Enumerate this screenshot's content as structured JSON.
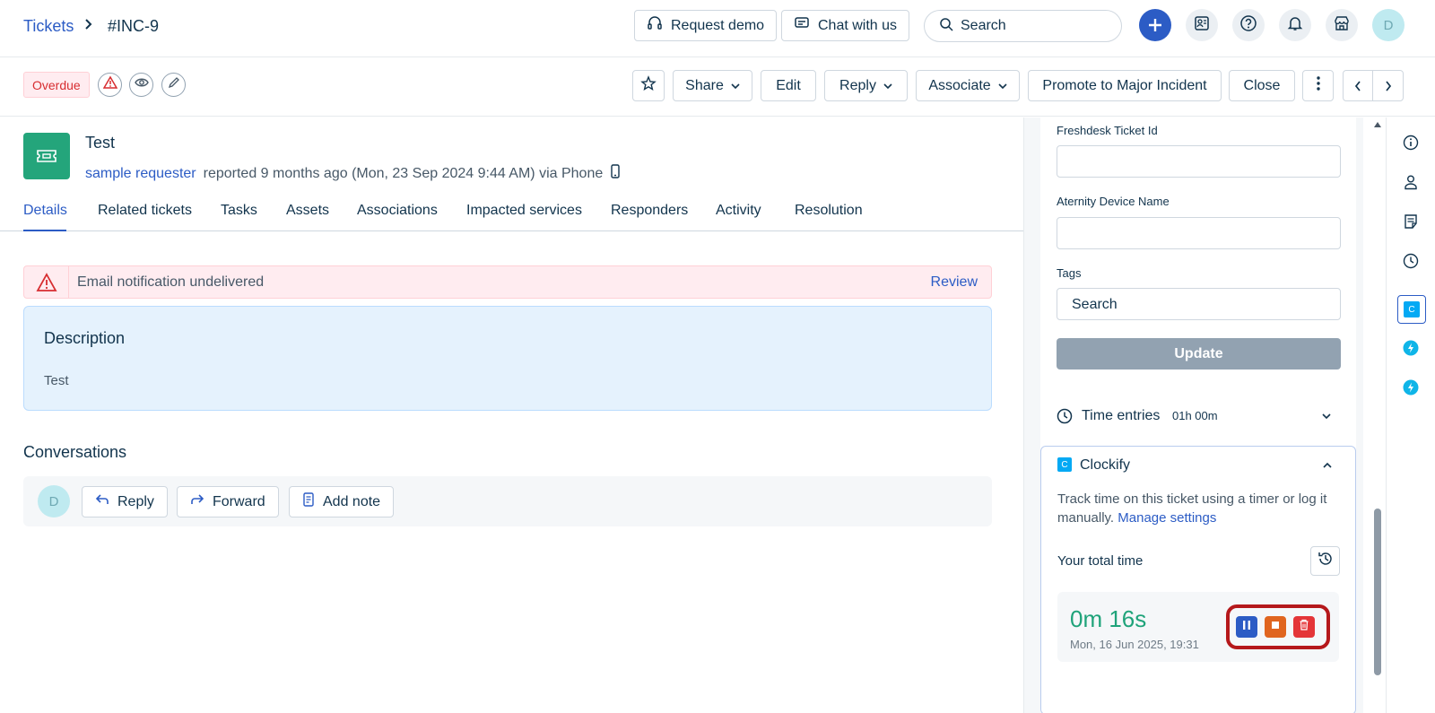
{
  "breadcrumb": {
    "root": "Tickets",
    "separator": ">",
    "current": "#INC-9"
  },
  "topbar": {
    "request_demo": "Request demo",
    "chat_with_us": "Chat with us",
    "search_placeholder": "Search",
    "avatar_initial": "D"
  },
  "actionbar": {
    "overdue_badge": "Overdue",
    "share": "Share",
    "edit": "Edit",
    "reply": "Reply",
    "associate": "Associate",
    "promote": "Promote to Major Incident",
    "close": "Close"
  },
  "ticket": {
    "subject": "Test",
    "requester": "sample requester",
    "meta": "reported 9 months ago (Mon, 23 Sep 2024 9:44 AM) via Phone"
  },
  "tabs": [
    "Details",
    "Related tickets",
    "Tasks",
    "Assets",
    "Associations",
    "Impacted services",
    "Responders",
    "Activity",
    "Resolution"
  ],
  "alert": {
    "message": "Email notification undelivered",
    "action": "Review"
  },
  "description": {
    "title": "Description",
    "body": "Test"
  },
  "conversations": {
    "title": "Conversations",
    "avatar_initial": "D",
    "reply": "Reply",
    "forward": "Forward",
    "add_note": "Add note"
  },
  "properties": {
    "freshdesk_label": "Freshdesk Ticket Id",
    "freshdesk_value": "",
    "aternity_label": "Aternity Device Name",
    "aternity_value": "",
    "tags_label": "Tags",
    "tags_placeholder": "Search",
    "update": "Update"
  },
  "time_entries": {
    "title": "Time entries",
    "total": "01h 00m"
  },
  "clockify": {
    "title": "Clockify",
    "logo_letter": "C",
    "description": "Track time on this ticket using a timer or log it manually.",
    "manage_link": "Manage settings",
    "total_time_label": "Your total time",
    "timer_value": "0m 16s",
    "timer_date": "Mon, 16 Jun 2025, 19:31"
  },
  "rail": {
    "clockify_letter": "C"
  },
  "colors": {
    "primary": "#2c5cc5",
    "timer_green": "#1fa37a",
    "pause": "#2c5cc5",
    "stop": "#e0651f",
    "delete": "#e43538",
    "highlight": "#b5181b"
  }
}
